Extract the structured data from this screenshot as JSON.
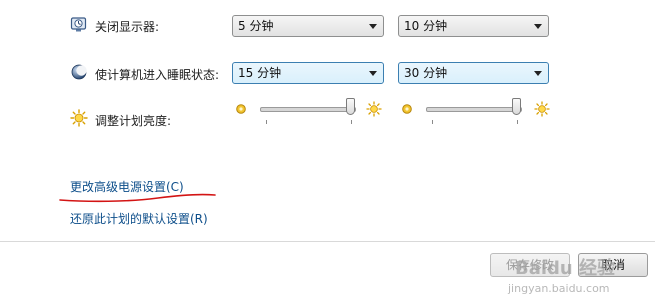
{
  "rows": [
    {
      "icon": "monitor-icon",
      "label": "关闭显示器:",
      "battery_value": "5 分钟",
      "plugged_value": "10 分钟"
    },
    {
      "icon": "sleep-moon-icon",
      "label": "使计算机进入睡眠状态:",
      "battery_value": "15 分钟",
      "plugged_value": "30 分钟"
    },
    {
      "icon": "brightness-sun-icon",
      "label": "调整计划亮度:",
      "battery_brightness": 1.0,
      "plugged_brightness": 1.0
    }
  ],
  "links": {
    "advanced": "更改高级电源设置(C)",
    "restore": "还原此计划的默认设置(R)"
  },
  "buttons": {
    "save": "保存修改",
    "cancel": "取消"
  },
  "watermark": {
    "brand": "Baidu 经验",
    "url": "jingyan.baidu.com"
  },
  "colors": {
    "link": "#0d4e8a",
    "annotation_underline": "#d31414",
    "active_select_border": "#3c7fb1"
  }
}
